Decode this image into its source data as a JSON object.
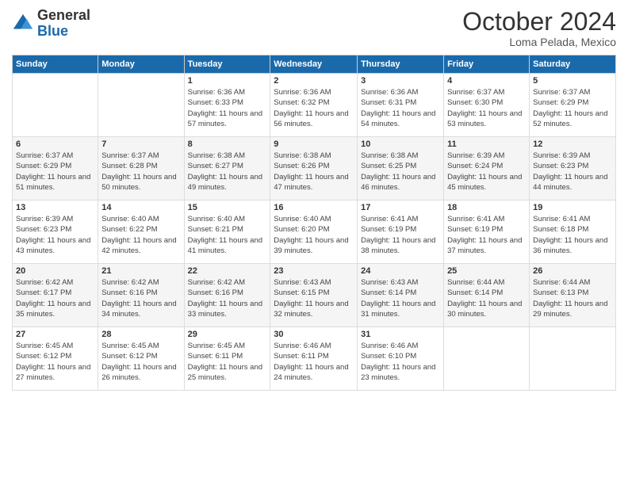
{
  "logo": {
    "general": "General",
    "blue": "Blue"
  },
  "header": {
    "month": "October 2024",
    "location": "Loma Pelada, Mexico"
  },
  "weekdays": [
    "Sunday",
    "Monday",
    "Tuesday",
    "Wednesday",
    "Thursday",
    "Friday",
    "Saturday"
  ],
  "weeks": [
    [
      {
        "day": "",
        "info": ""
      },
      {
        "day": "",
        "info": ""
      },
      {
        "day": "1",
        "info": "Sunrise: 6:36 AM\nSunset: 6:33 PM\nDaylight: 11 hours and 57 minutes."
      },
      {
        "day": "2",
        "info": "Sunrise: 6:36 AM\nSunset: 6:32 PM\nDaylight: 11 hours and 56 minutes."
      },
      {
        "day": "3",
        "info": "Sunrise: 6:36 AM\nSunset: 6:31 PM\nDaylight: 11 hours and 54 minutes."
      },
      {
        "day": "4",
        "info": "Sunrise: 6:37 AM\nSunset: 6:30 PM\nDaylight: 11 hours and 53 minutes."
      },
      {
        "day": "5",
        "info": "Sunrise: 6:37 AM\nSunset: 6:29 PM\nDaylight: 11 hours and 52 minutes."
      }
    ],
    [
      {
        "day": "6",
        "info": "Sunrise: 6:37 AM\nSunset: 6:29 PM\nDaylight: 11 hours and 51 minutes."
      },
      {
        "day": "7",
        "info": "Sunrise: 6:37 AM\nSunset: 6:28 PM\nDaylight: 11 hours and 50 minutes."
      },
      {
        "day": "8",
        "info": "Sunrise: 6:38 AM\nSunset: 6:27 PM\nDaylight: 11 hours and 49 minutes."
      },
      {
        "day": "9",
        "info": "Sunrise: 6:38 AM\nSunset: 6:26 PM\nDaylight: 11 hours and 47 minutes."
      },
      {
        "day": "10",
        "info": "Sunrise: 6:38 AM\nSunset: 6:25 PM\nDaylight: 11 hours and 46 minutes."
      },
      {
        "day": "11",
        "info": "Sunrise: 6:39 AM\nSunset: 6:24 PM\nDaylight: 11 hours and 45 minutes."
      },
      {
        "day": "12",
        "info": "Sunrise: 6:39 AM\nSunset: 6:23 PM\nDaylight: 11 hours and 44 minutes."
      }
    ],
    [
      {
        "day": "13",
        "info": "Sunrise: 6:39 AM\nSunset: 6:23 PM\nDaylight: 11 hours and 43 minutes."
      },
      {
        "day": "14",
        "info": "Sunrise: 6:40 AM\nSunset: 6:22 PM\nDaylight: 11 hours and 42 minutes."
      },
      {
        "day": "15",
        "info": "Sunrise: 6:40 AM\nSunset: 6:21 PM\nDaylight: 11 hours and 41 minutes."
      },
      {
        "day": "16",
        "info": "Sunrise: 6:40 AM\nSunset: 6:20 PM\nDaylight: 11 hours and 39 minutes."
      },
      {
        "day": "17",
        "info": "Sunrise: 6:41 AM\nSunset: 6:19 PM\nDaylight: 11 hours and 38 minutes."
      },
      {
        "day": "18",
        "info": "Sunrise: 6:41 AM\nSunset: 6:19 PM\nDaylight: 11 hours and 37 minutes."
      },
      {
        "day": "19",
        "info": "Sunrise: 6:41 AM\nSunset: 6:18 PM\nDaylight: 11 hours and 36 minutes."
      }
    ],
    [
      {
        "day": "20",
        "info": "Sunrise: 6:42 AM\nSunset: 6:17 PM\nDaylight: 11 hours and 35 minutes."
      },
      {
        "day": "21",
        "info": "Sunrise: 6:42 AM\nSunset: 6:16 PM\nDaylight: 11 hours and 34 minutes."
      },
      {
        "day": "22",
        "info": "Sunrise: 6:42 AM\nSunset: 6:16 PM\nDaylight: 11 hours and 33 minutes."
      },
      {
        "day": "23",
        "info": "Sunrise: 6:43 AM\nSunset: 6:15 PM\nDaylight: 11 hours and 32 minutes."
      },
      {
        "day": "24",
        "info": "Sunrise: 6:43 AM\nSunset: 6:14 PM\nDaylight: 11 hours and 31 minutes."
      },
      {
        "day": "25",
        "info": "Sunrise: 6:44 AM\nSunset: 6:14 PM\nDaylight: 11 hours and 30 minutes."
      },
      {
        "day": "26",
        "info": "Sunrise: 6:44 AM\nSunset: 6:13 PM\nDaylight: 11 hours and 29 minutes."
      }
    ],
    [
      {
        "day": "27",
        "info": "Sunrise: 6:45 AM\nSunset: 6:12 PM\nDaylight: 11 hours and 27 minutes."
      },
      {
        "day": "28",
        "info": "Sunrise: 6:45 AM\nSunset: 6:12 PM\nDaylight: 11 hours and 26 minutes."
      },
      {
        "day": "29",
        "info": "Sunrise: 6:45 AM\nSunset: 6:11 PM\nDaylight: 11 hours and 25 minutes."
      },
      {
        "day": "30",
        "info": "Sunrise: 6:46 AM\nSunset: 6:11 PM\nDaylight: 11 hours and 24 minutes."
      },
      {
        "day": "31",
        "info": "Sunrise: 6:46 AM\nSunset: 6:10 PM\nDaylight: 11 hours and 23 minutes."
      },
      {
        "day": "",
        "info": ""
      },
      {
        "day": "",
        "info": ""
      }
    ]
  ]
}
